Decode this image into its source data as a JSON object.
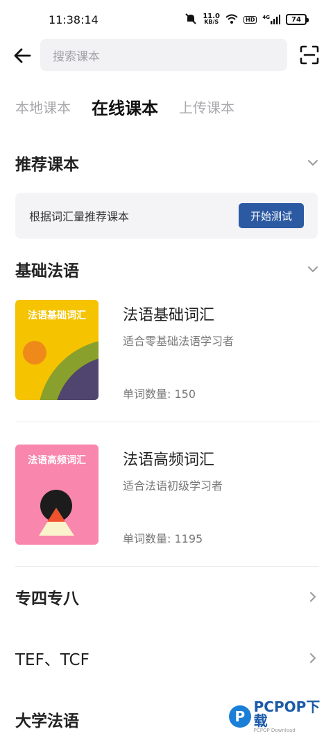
{
  "status_bar": {
    "time": "11:38:14",
    "net_speed_value": "11.0",
    "net_speed_unit": "KB/S",
    "hd": "HD",
    "signal": "4G",
    "battery": "74"
  },
  "search": {
    "placeholder": "搜索课本"
  },
  "tabs": [
    {
      "label": "本地课本",
      "active": false
    },
    {
      "label": "在线课本",
      "active": true
    },
    {
      "label": "上传课本",
      "active": false
    }
  ],
  "recommend": {
    "title": "推荐课本",
    "card_text": "根据词汇量推荐课本",
    "button_label": "开始测试"
  },
  "basic": {
    "title": "基础法语",
    "books": [
      {
        "cover_label": "法语基础词汇",
        "title": "法语基础词汇",
        "desc": "适合零基础法语学习者",
        "count": "单词数量: 150"
      },
      {
        "cover_label": "法语高频词汇",
        "title": "法语高频词汇",
        "desc": "适合法语初级学习者",
        "count": "单词数量: 1195"
      }
    ]
  },
  "categories": [
    {
      "label": "专四专八"
    },
    {
      "label": "TEF、TCF"
    },
    {
      "label": "大学法语"
    }
  ],
  "watermark": {
    "brand": "PCPOP下载",
    "sub": "PCPOP Download"
  },
  "colors": {
    "accent": "#2b5aa3",
    "cover1_bg": "#f5c300",
    "cover2_bg": "#f986ad"
  }
}
